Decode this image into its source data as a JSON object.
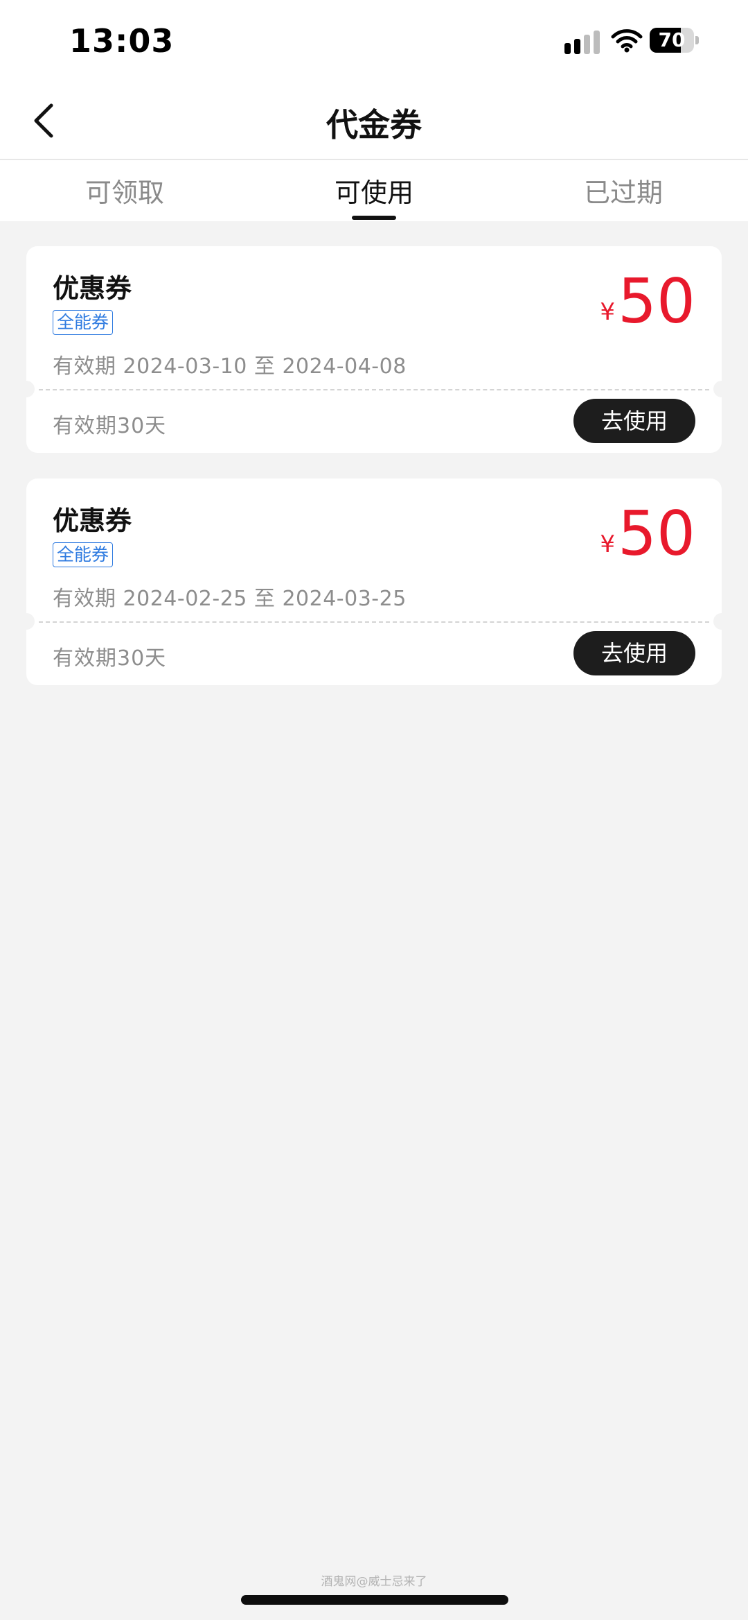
{
  "status_bar": {
    "time": "13:03",
    "battery_level": "70",
    "battery_fraction": 0.7,
    "icons": [
      "signal-icon",
      "wifi-icon",
      "battery-icon"
    ]
  },
  "header": {
    "title": "代金券",
    "back_icon": "chevron-left-icon"
  },
  "tabs": [
    {
      "label": "可领取",
      "active": false
    },
    {
      "label": "可使用",
      "active": true
    },
    {
      "label": "已过期",
      "active": false
    }
  ],
  "coupons": [
    {
      "name": "优惠券",
      "tag": "全能券",
      "date_range": "有效期 2024-03-10 至 2024-04-08",
      "currency": "¥",
      "amount": "50",
      "validity": "有效期30天",
      "button_label": "去使用"
    },
    {
      "name": "优惠券",
      "tag": "全能券",
      "date_range": "有效期 2024-02-25 至 2024-03-25",
      "currency": "¥",
      "amount": "50",
      "validity": "有效期30天",
      "button_label": "去使用"
    }
  ],
  "footer": {
    "watermark": "酒鬼网@威士忌来了"
  },
  "colors": {
    "accent_red": "#e8192c",
    "tag_blue": "#2f7be0",
    "button_dark": "#1d1d1d",
    "background": "#f3f3f3"
  }
}
